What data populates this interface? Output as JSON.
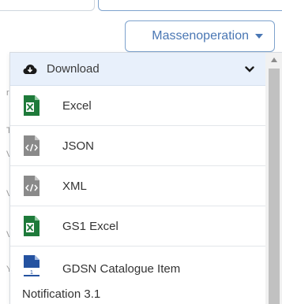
{
  "toolbar": {
    "mass_operation_label": "Massenoperation",
    "accent_color": "#4a77b4"
  },
  "dropdown": {
    "section_label": "Download",
    "section_icon": "cloud-download-icon",
    "items": [
      {
        "label": "Excel",
        "icon": "excel-file-icon",
        "color": "#1e7a3a"
      },
      {
        "label": "JSON",
        "icon": "code-file-icon",
        "color": "#8a8a8a"
      },
      {
        "label": "XML",
        "icon": "code-file-icon",
        "color": "#8a8a8a"
      },
      {
        "label": "GS1 Excel",
        "icon": "excel-file-icon",
        "color": "#1e7a3a"
      },
      {
        "label": "GDSN Catalogue Item",
        "label_cont": "Notification 3.1",
        "icon": "gdsn-file-icon",
        "color": "#2452a0"
      }
    ]
  }
}
